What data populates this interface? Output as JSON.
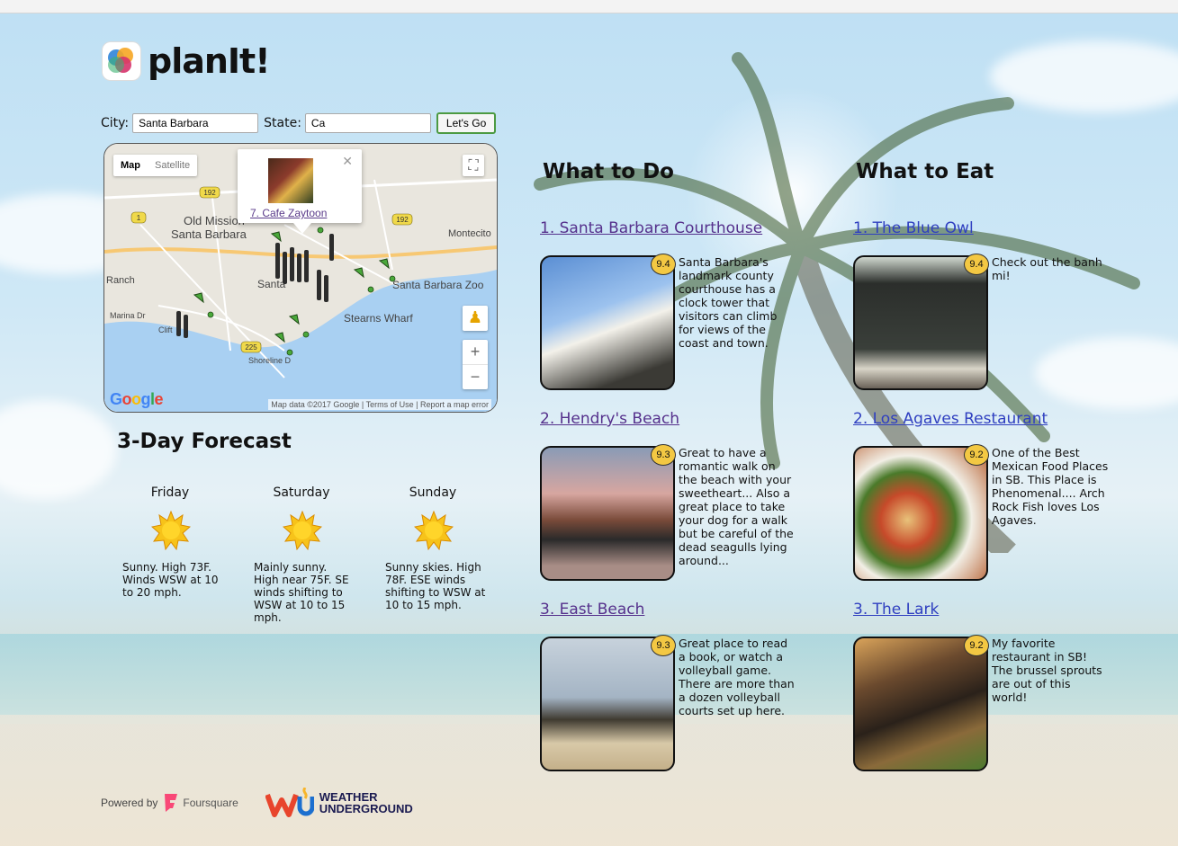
{
  "app": {
    "name": "planIt!"
  },
  "search": {
    "city_label": "City:",
    "city_value": "Santa Barbara",
    "state_label": "State:",
    "state_value": "Ca",
    "go_label": "Let's Go"
  },
  "map": {
    "toggle_map": "Map",
    "toggle_satellite": "Satellite",
    "popup_link": "7. Cafe Zaytoon",
    "labels": [
      "Old Mission",
      "Santa Barbara",
      "Montecito",
      "Santa Barbara Zoo",
      "Stearns Wharf",
      "Santa",
      "Marina Dr",
      "Shoreline D",
      "Ranch",
      "Clift"
    ],
    "route_shields": [
      "192",
      "1",
      "192",
      "192",
      "225"
    ],
    "google": "Google",
    "attribution": "Map data ©2017 Google | Terms of Use | Report a map error"
  },
  "forecast": {
    "title": "3-Day Forecast",
    "days": [
      {
        "name": "Friday",
        "icon": "sun-icon",
        "text": "Sunny. High 73F. Winds WSW at 10 to 20 mph."
      },
      {
        "name": "Saturday",
        "icon": "sun-icon",
        "text": "Mainly sunny. High near 75F. SE winds shifting to WSW at 10 to 15 mph."
      },
      {
        "name": "Sunday",
        "icon": "sun-icon",
        "text": "Sunny skies. High 78F. ESE winds shifting to WSW at 10 to 15 mph."
      }
    ]
  },
  "todo": {
    "title": "What to Do",
    "items": [
      {
        "name": "1. Santa Barbara Courthouse",
        "score": "9.4",
        "desc": "Santa Barbara's landmark county courthouse has a clock tower that visitors can climb for views of the coast and town."
      },
      {
        "name": "2. Hendry's Beach",
        "score": "9.3",
        "desc": "Great to have a romantic walk on the beach with your sweetheart... Also a great place to take your dog for a walk but be careful of the dead seagulls lying around..."
      },
      {
        "name": "3. East Beach",
        "score": "9.3",
        "desc": "Great place to read a book, or watch a volleyball game. There are more than a dozen volleyball courts set up here."
      }
    ]
  },
  "eat": {
    "title": "What to Eat",
    "items": [
      {
        "name": "1. The Blue Owl",
        "score": "9.4",
        "desc": "Check out the banh mi!"
      },
      {
        "name": "2. Los Agaves Restaurant",
        "score": "9.2",
        "desc": "One of the Best Mexican Food Places in SB. This Place is Phenomenal.... Arch Rock Fish loves Los Agaves."
      },
      {
        "name": "3. The Lark",
        "score": "9.2",
        "desc": "My favorite restaurant in SB! The brussel sprouts are out of this world!"
      }
    ]
  },
  "footer": {
    "powered": "Powered by",
    "foursquare": "Foursquare",
    "wu_line1": "WEATHER",
    "wu_line2": "UNDERGROUND"
  }
}
